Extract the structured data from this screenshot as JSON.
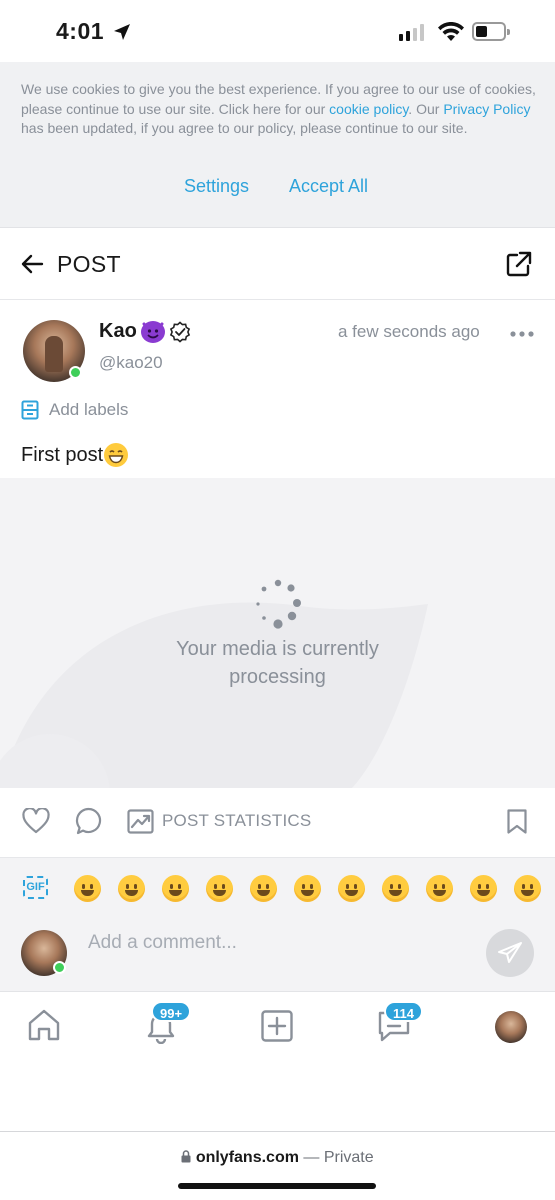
{
  "status_bar": {
    "time": "4:01"
  },
  "cookie_banner": {
    "text_1": "We use cookies to give you the best experience. If you agree to our use of cookies, please continue to use our site. Click here for our ",
    "link_cookie": "cookie policy",
    "text_2": ". Our ",
    "link_privacy": "Privacy Policy",
    "text_3": " has been updated, if you agree to our policy, please continue to our site.",
    "settings_label": "Settings",
    "accept_label": "Accept All",
    "link_color": "#2ea3db"
  },
  "header": {
    "title": "POST"
  },
  "post": {
    "author_name": "Kao",
    "author_handle": "@kao20",
    "timestamp": "a few seconds ago",
    "labels_action": "Add labels",
    "text": "First post",
    "media_status_line1": "Your media is currently",
    "media_status_line2": "processing",
    "stats_label": "POST STATISTICS"
  },
  "comment": {
    "gif_label": "GIF",
    "placeholder": "Add a comment...",
    "emoji_picker": [
      "grinning-face",
      "beaming-face",
      "tears-of-joy",
      "grinning-big-eyes",
      "grinning-smiling-eyes",
      "grinning-sweat",
      "squinting-face",
      "winking-face",
      "smiling-face",
      "savoring-food",
      "relieved-face"
    ]
  },
  "tabbar": {
    "notifications_badge": "99+",
    "messages_badge": "114"
  },
  "url_bar": {
    "domain": "onlyfans.com",
    "suffix": " — Private"
  },
  "colors": {
    "accent": "#2ea3db",
    "muted_text": "#8a9099",
    "online": "#3fcf5a"
  }
}
